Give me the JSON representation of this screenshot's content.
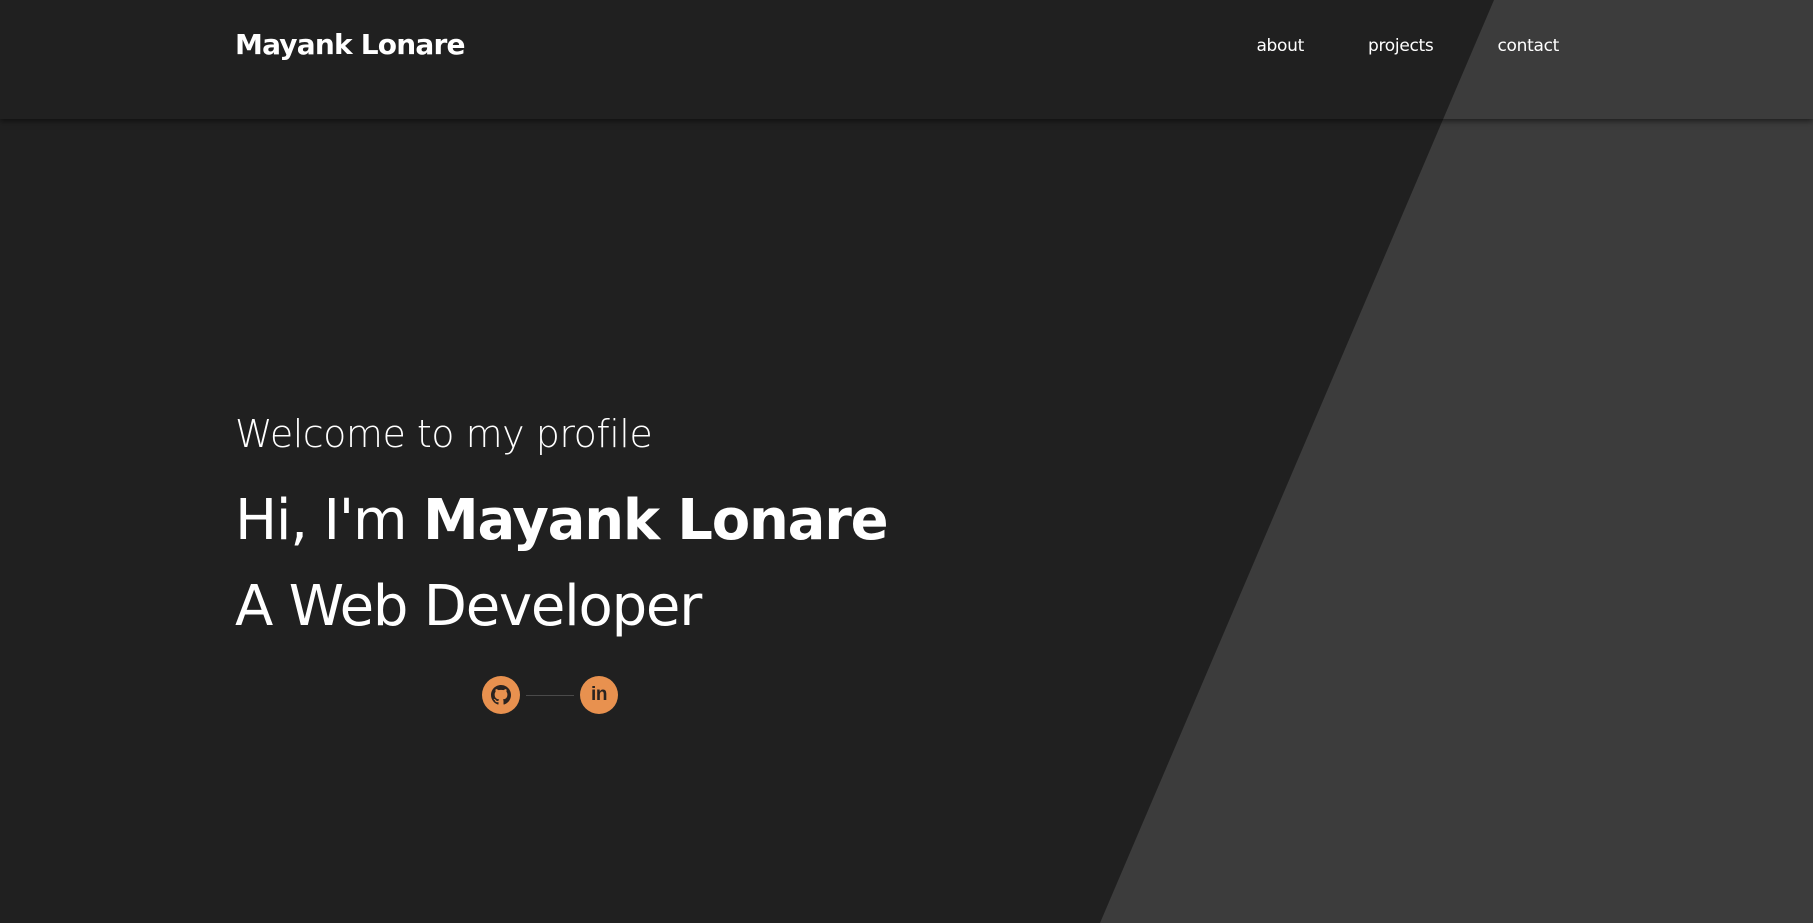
{
  "nav": {
    "brand": "Mayank Lonare",
    "links": [
      {
        "label": "about"
      },
      {
        "label": "projects"
      },
      {
        "label": "contact"
      }
    ]
  },
  "hero": {
    "welcome": "Welcome to my profile",
    "greeting_prefix": "Hi, I'm ",
    "name": "Mayank Lonare",
    "role": "A Web Developer"
  },
  "socials": {
    "github_icon": "github-icon",
    "linkedin_icon": "linkedin-icon",
    "linkedin_glyph": "in"
  },
  "colors": {
    "background": "#202020",
    "diagonal_panel": "#3c3c3c",
    "accent": "#e8914f",
    "text": "#ffffff"
  }
}
